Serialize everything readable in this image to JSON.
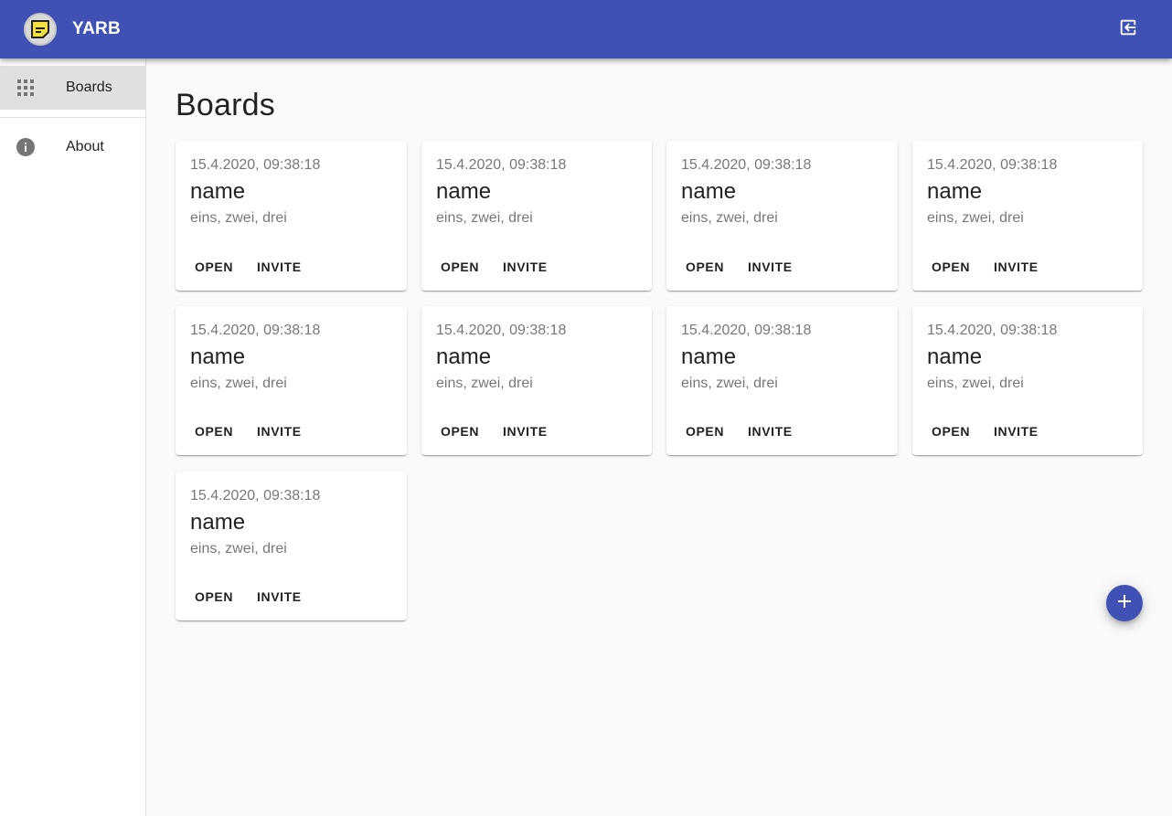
{
  "app": {
    "title": "YARB",
    "brand_color": "#3f51b5",
    "logo_icon": "sticky-note-icon",
    "logout_icon": "exit-to-app-icon"
  },
  "sidebar": {
    "items": [
      {
        "label": "Boards",
        "icon": "apps-grid-icon",
        "selected": true
      },
      {
        "label": "About",
        "icon": "info-icon",
        "selected": false
      }
    ]
  },
  "main": {
    "title": "Boards",
    "boards": [
      {
        "date": "15.4.2020, 09:38:18",
        "name": "name",
        "tags": "eins, zwei, drei",
        "open_label": "OPEN",
        "invite_label": "INVITE"
      },
      {
        "date": "15.4.2020, 09:38:18",
        "name": "name",
        "tags": "eins, zwei, drei",
        "open_label": "OPEN",
        "invite_label": "INVITE"
      },
      {
        "date": "15.4.2020, 09:38:18",
        "name": "name",
        "tags": "eins, zwei, drei",
        "open_label": "OPEN",
        "invite_label": "INVITE"
      },
      {
        "date": "15.4.2020, 09:38:18",
        "name": "name",
        "tags": "eins, zwei, drei",
        "open_label": "OPEN",
        "invite_label": "INVITE"
      },
      {
        "date": "15.4.2020, 09:38:18",
        "name": "name",
        "tags": "eins, zwei, drei",
        "open_label": "OPEN",
        "invite_label": "INVITE"
      },
      {
        "date": "15.4.2020, 09:38:18",
        "name": "name",
        "tags": "eins, zwei, drei",
        "open_label": "OPEN",
        "invite_label": "INVITE"
      },
      {
        "date": "15.4.2020, 09:38:18",
        "name": "name",
        "tags": "eins, zwei, drei",
        "open_label": "OPEN",
        "invite_label": "INVITE"
      },
      {
        "date": "15.4.2020, 09:38:18",
        "name": "name",
        "tags": "eins, zwei, drei",
        "open_label": "OPEN",
        "invite_label": "INVITE"
      },
      {
        "date": "15.4.2020, 09:38:18",
        "name": "name",
        "tags": "eins, zwei, drei",
        "open_label": "OPEN",
        "invite_label": "INVITE"
      }
    ],
    "fab_icon": "add-icon"
  }
}
